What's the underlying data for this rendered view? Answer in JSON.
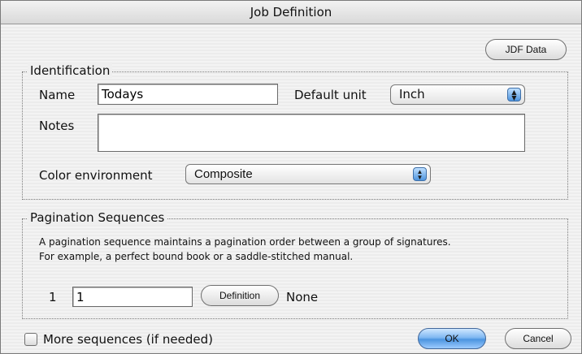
{
  "window": {
    "title": "Job Definition"
  },
  "buttons": {
    "jdf_data": "JDF Data",
    "definition": "Definition",
    "ok": "OK",
    "cancel": "Cancel"
  },
  "identification": {
    "legend": "Identification",
    "name_label": "Name",
    "name_value": "Todays",
    "default_unit_label": "Default unit",
    "default_unit_value": "Inch",
    "notes_label": "Notes",
    "notes_value": "",
    "color_env_label": "Color environment",
    "color_env_value": "Composite"
  },
  "pagination": {
    "legend": "Pagination Sequences",
    "description_line1": "A pagination sequence maintains a pagination order between a group of signatures.",
    "description_line2": "For example, a perfect bound book or a saddle-stitched manual.",
    "row_index": "1",
    "row_value": "1",
    "row_status": "None"
  },
  "more_sequences": {
    "label": "More sequences (if needed)",
    "checked": false
  },
  "icons": {
    "popup_arrows": "up-down-arrows-icon"
  }
}
